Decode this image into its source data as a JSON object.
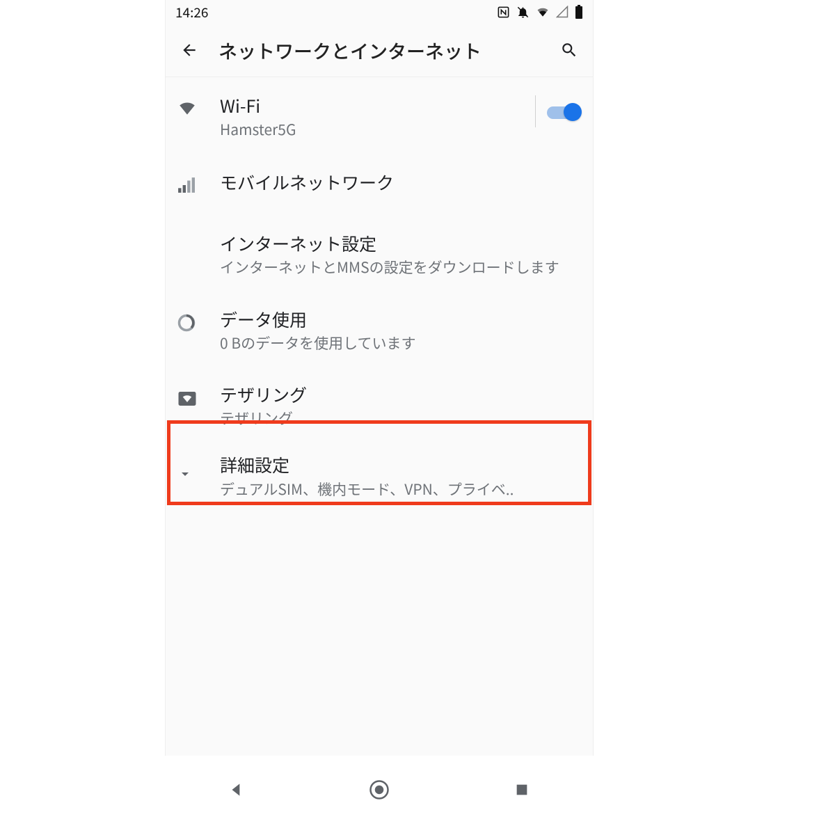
{
  "statusbar": {
    "time": "14:26"
  },
  "appbar": {
    "title": "ネットワークとインターネット"
  },
  "wifi": {
    "title": "Wi-Fi",
    "subtitle": "Hamster5G",
    "toggle_on": true
  },
  "mobile": {
    "title": "モバイルネットワーク"
  },
  "internet_settings": {
    "title": "インターネット設定",
    "subtitle": "インターネットとMMSの設定をダウンロードします"
  },
  "data_usage": {
    "title": "データ使用",
    "subtitle": "0 Bのデータを使用しています"
  },
  "tethering": {
    "title": "テザリング",
    "subtitle": "テザリング"
  },
  "advanced": {
    "title": "詳細設定",
    "subtitle": "デュアルSIM、機内モード、VPN、プライベ.."
  }
}
